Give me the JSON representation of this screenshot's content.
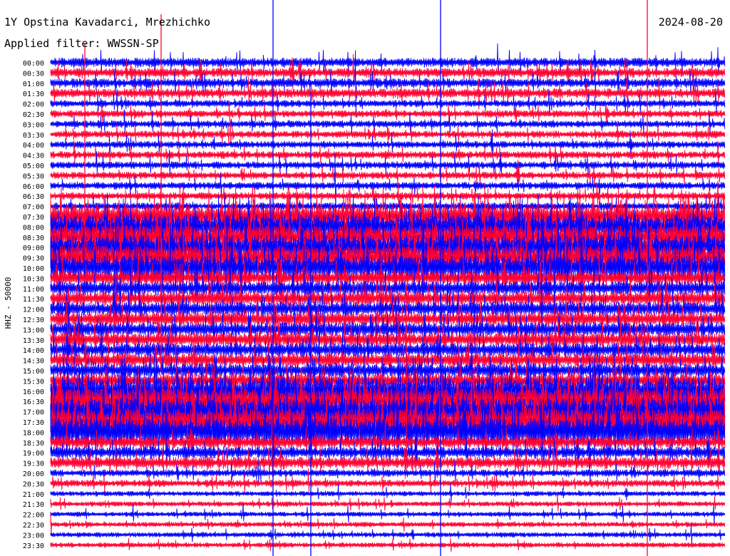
{
  "header": {
    "station": "1Y Opstina Kavadarci, Mrezhichko",
    "date": "2024-08-20",
    "filter": "Applied filter: WWSSN-SP"
  },
  "axis": {
    "y_label": "HHZ - 50000"
  },
  "chart_data": {
    "type": "line",
    "title": "1Y Opstina Kavadarci, Mrezhichko",
    "date": "2024-08-20",
    "ylabel": "HHZ - 50000",
    "row_interval_minutes": 30,
    "row_labels": [
      "00:00",
      "00:30",
      "01:00",
      "01:30",
      "02:00",
      "02:30",
      "03:00",
      "03:30",
      "04:00",
      "04:30",
      "05:00",
      "05:30",
      "06:00",
      "06:30",
      "07:00",
      "07:30",
      "08:00",
      "08:30",
      "09:00",
      "09:30",
      "10:00",
      "10:30",
      "11:00",
      "11:30",
      "12:00",
      "12:30",
      "13:00",
      "13:30",
      "14:00",
      "14:30",
      "15:00",
      "15:30",
      "16:00",
      "16:30",
      "17:00",
      "17:30",
      "18:00",
      "18:30",
      "19:00",
      "19:30",
      "20:00",
      "20:30",
      "21:00",
      "21:30",
      "22:00",
      "22:30",
      "23:00",
      "23:30"
    ],
    "trace_colors": [
      "#0000ff",
      "#ff0033"
    ],
    "grid": false,
    "legend": "none"
  }
}
